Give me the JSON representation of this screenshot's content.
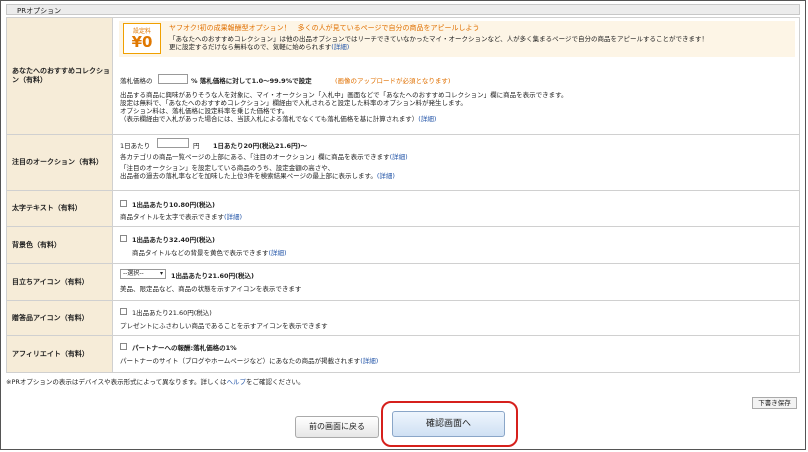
{
  "section": {
    "title": "PRオプション"
  },
  "recommend": {
    "label": "あなたへのおすすめコレクション（有料）",
    "badge_top": "設定料",
    "badge_price": "¥0",
    "headline": "ヤフオク!初の成果報酬型オプション！　多くの人が見ているページで自分の商品をアピールしよう",
    "desc1": "「あなたへのおすすめコレクション」は他の出品オプションではリーチできていなかったマイ・オークションなど、人が多く集まるページで自分の商品をアピールすることができます！",
    "desc2": "更に設定するだけなら無料なので、気軽に始められます",
    "desc2_link": "(詳細)",
    "rate_prefix": "落札価格の",
    "rate_value": "",
    "rate_suffix": "%  落札価格に対して1.0〜99.9%で設定",
    "rate_note": "(画像のアップロードが必須となります)",
    "body1": "出品する商品に興味がありそうな人を対象に、マイ・オークション「入札中」画面などで「あなたへのおすすめコレクション」欄に商品を表示できます。",
    "body2": "設定は無料で、「あなたへのおすすめコレクション」欄経由で入札されると設定した料率のオプション料が発生します。",
    "body3": "オプション料は、落札価格に設定料率を乗じた価格です。",
    "body4": "（表示欄経由で入札があった場合には、当該入札による落札でなくても落札価格を基に計算されます）",
    "body4_link": "(詳細)"
  },
  "featured": {
    "label": "注目のオークション（有料）",
    "prefix": "1日あたり",
    "value": "",
    "unit": "円",
    "note": "1日あたり20円(税込21.6円)〜",
    "line1": "各カテゴリの商品一覧ページの上部にある、「注目のオークション」欄に商品を表示できます",
    "line1_link": "(詳細)",
    "line2": "「注目のオークション」を設定している商品のうち、設定金額の高さや、",
    "line3": "出品者の過去の落札率などを加味した上位3件を検索結果ページの最上部に表示します。",
    "line3_link": "(詳細)"
  },
  "bold_text": {
    "label": "太字テキスト（有料）",
    "price": "1出品あたり10.80円(税込)",
    "desc": "商品タイトルを太字で表示できます",
    "link": "(詳細)"
  },
  "bg_color": {
    "label": "背景色（有料）",
    "price": "1出品あたり32.40円(税込)",
    "desc": "商品タイトルなどの背景を黄色で表示できます",
    "link": "(詳細)"
  },
  "icon": {
    "label": "目立ちアイコン（有料）",
    "select": "--選択--",
    "price": "1出品あたり21.60円(税込)",
    "desc": "美品、限定品など、商品の状態を示すアイコンを表示できます"
  },
  "gift": {
    "label": "贈答品アイコン（有料）",
    "price": "1出品あたり21.60円(税込)",
    "desc": "プレゼントにふさわしい商品であることを示すアイコンを表示できます"
  },
  "affiliate": {
    "label": "アフィリエイト（有料）",
    "price": "パートナーへの報酬:落札価格の1%",
    "desc": "パートナーのサイト（ブログやホームページなど）にあなたの商品が掲載されます",
    "link": "(詳細)"
  },
  "footer": {
    "note_prefix": "※PRオプションの表示はデバイスや表示形式によって異なります。詳しくは",
    "note_link": "ヘルプ",
    "note_suffix": "をご確認ください。",
    "draft": "下書き保存",
    "back": "前の画面に戻る",
    "confirm": "確認画面へ"
  },
  "colors": {
    "label_bg": "#f6ecd8",
    "banner_bg": "#fdf5e6",
    "accent": "#e07800",
    "link": "#2355a8",
    "highlight": "#d6201c"
  }
}
